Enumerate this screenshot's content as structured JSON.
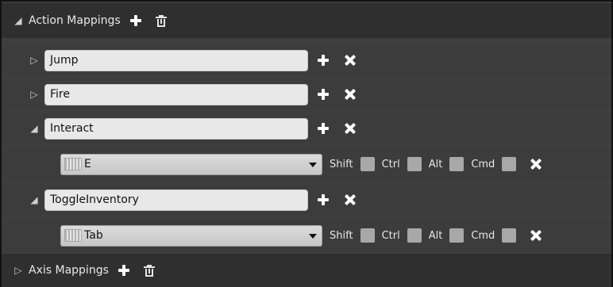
{
  "action_section": {
    "label": "Action Mappings"
  },
  "actions": [
    {
      "name": "Jump",
      "expanded": false
    },
    {
      "name": "Fire",
      "expanded": false
    },
    {
      "name": "Interact",
      "expanded": true,
      "key": "E"
    },
    {
      "name": "ToggleInventory",
      "expanded": true,
      "key": "Tab"
    }
  ],
  "modifiers": {
    "shift": "Shift",
    "ctrl": "Ctrl",
    "alt": "Alt",
    "cmd": "Cmd"
  },
  "axis_section": {
    "label": "Axis Mappings"
  },
  "icons": {
    "expanded": "triangle-down-icon",
    "collapsed": "triangle-right-icon",
    "add": "plus-icon",
    "remove": "close-icon",
    "delete": "trash-icon",
    "key": "keyboard-icon"
  },
  "colors": {
    "panel_bg": "#3e3e3e",
    "section_bg": "#2f2f2f",
    "field_bg": "#e8e8e8"
  }
}
